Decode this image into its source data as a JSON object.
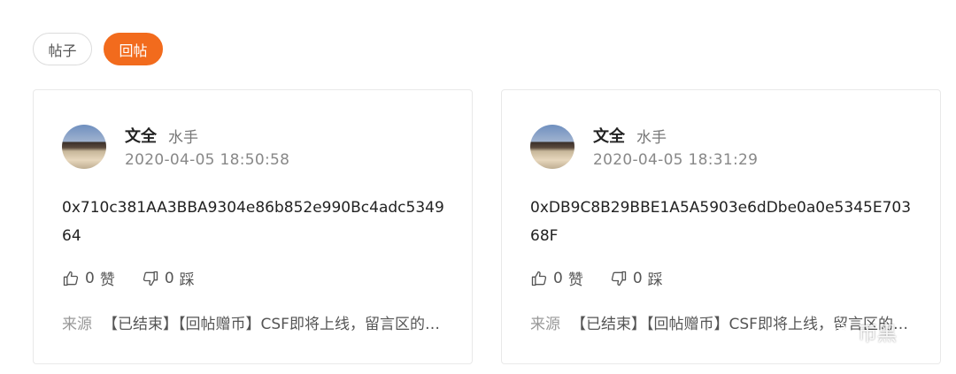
{
  "tabs": [
    {
      "label": "帖子",
      "active": false
    },
    {
      "label": "回帖",
      "active": true
    }
  ],
  "posts": [
    {
      "username": "文全",
      "role": "水手",
      "time": "2020-04-05 18:50:58",
      "content": "0x710c381AA3BBA9304e86b852e990Bc4adc534964",
      "likes": "0",
      "like_label": "赞",
      "dislikes": "0",
      "dislike_label": "踩",
      "source_label": "来源",
      "source_text": "【已结束】【回帖赠币】CSF即将上线，留言区的朋友们"
    },
    {
      "username": "文全",
      "role": "水手",
      "time": "2020-04-05 18:31:29",
      "content": "0xDB9C8B29BBE1A5A5903e6dDbe0a0e5345E70368F",
      "likes": "0",
      "like_label": "赞",
      "dislikes": "0",
      "dislike_label": "踩",
      "source_label": "来源",
      "source_text": "【已结束】【回帖赠币】CSF即将上线，留言区的朋友们"
    }
  ],
  "watermark": {
    "text": "币黑",
    "icon": "wechat-icon"
  },
  "colors": {
    "accent": "#f26b1d",
    "border": "#e9e9e9",
    "muted": "#888888"
  }
}
